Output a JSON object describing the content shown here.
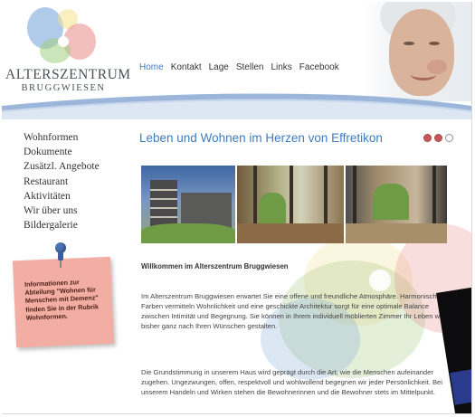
{
  "logo": {
    "title": "ALTERSZENTRUM",
    "subtitle": "BRUGGWIESEN"
  },
  "top_nav": {
    "items": [
      {
        "label": "Home",
        "active": true
      },
      {
        "label": "Kontakt"
      },
      {
        "label": "Lage"
      },
      {
        "label": "Stellen"
      },
      {
        "label": "Links"
      },
      {
        "label": "Facebook"
      }
    ]
  },
  "side_nav": {
    "items": [
      {
        "label": "Wohnformen"
      },
      {
        "label": "Dokumente"
      },
      {
        "label": "Zusätzl. Angebote"
      },
      {
        "label": "Restaurant"
      },
      {
        "label": "Aktivitäten"
      },
      {
        "label": "Wir über uns"
      },
      {
        "label": "Bildergalerie"
      }
    ]
  },
  "note": {
    "text": "Informationen zur Abteilung \"Wohnen für Menschen mit Demenz\" finden Sie in der Rubrik Wohnformen."
  },
  "main": {
    "heading": "Leben und Wohnen im Herzen von Effretikon",
    "slider_dots": [
      {
        "state": "active"
      },
      {
        "state": "active"
      },
      {
        "state": "inactive"
      }
    ],
    "intro_title": "Willkommen im Alterszentrum Bruggwiesen",
    "paragraphs": [
      "Im Alterszentrum Bruggwiesen erwartet Sie eine offene und freundliche Atmosphäre. Harmonische Farben vermitteln Wohnlichkeit und eine geschickte Architektur sorgt für eine optimale Balance zwischen Intimität und Begegnung. Sie können in Ihrem individuell möblierten Zimmer Ihr Leben wie bisher ganz nach Ihren Wünschen gestalten.",
      "Die Grundstimmung in unserem Haus wird geprägt durch die Art, wie die Menschen aufeinander zugehen. Ungezwungen, offen, respektvoll und wohlwollend begegnen wir jeder Persönlichkeit. Bei unserem Handeln und Wirken stehen die Bewohnerinnen und die Bewohner stets im Mittelpunkt."
    ]
  },
  "colors": {
    "accent_blue": "#3d7cc2",
    "note_pink": "#f3aea4",
    "text_gray": "#444444"
  }
}
